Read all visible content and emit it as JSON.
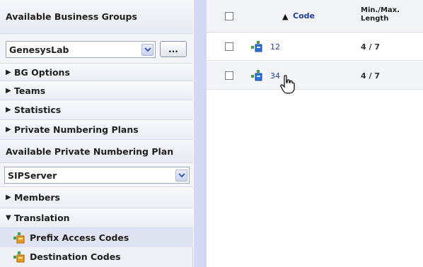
{
  "left_panel": {
    "business_groups_header": "Available Business Groups",
    "business_group_selected": "GenesysLab",
    "more_button_label": "...",
    "bg_items": [
      "BG Options",
      "Teams",
      "Statistics",
      "Private Numbering Plans"
    ],
    "private_plan_header": "Available Private Numbering Plan",
    "private_plan_selected": "SIPServer",
    "plan_items": [
      "Members",
      "Translation"
    ],
    "translation_items": [
      "Prefix Access Codes",
      "Destination Codes"
    ]
  },
  "grid": {
    "columns": {
      "code": "Code",
      "length": [
        "Min./Max.",
        "Length"
      ]
    },
    "rows": [
      {
        "code": "12",
        "length": "4 / 7"
      },
      {
        "code": "34",
        "length": "4 / 7"
      }
    ]
  },
  "colors": {
    "link": "#2b3fa8",
    "strip": "#d3d8f3",
    "selected": "#dfe3f2"
  },
  "icons": [
    "dropdown-arrow-icon",
    "expand-triangle-icon",
    "collapse-triangle-icon",
    "prefix-code-icon",
    "destination-code-icon",
    "row-item-icon",
    "hand-cursor-icon"
  ]
}
